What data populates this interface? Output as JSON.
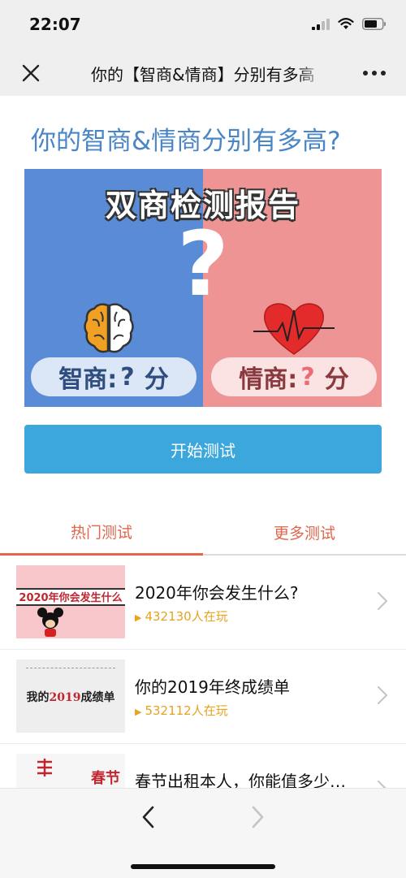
{
  "status": {
    "time": "22:07"
  },
  "nav": {
    "title": "你的【智商&情商】分别有多高"
  },
  "page": {
    "heading": "你的智商&情商分别有多高?"
  },
  "banner": {
    "title": "双商检测报告",
    "big_mark": "?",
    "iq_label": "智商:",
    "eq_label": "情商:",
    "score_placeholder": "?",
    "score_unit": "分"
  },
  "start_button": "开始测试",
  "tabs": [
    {
      "label": "热门测试",
      "active": true
    },
    {
      "label": "更多测试",
      "active": false
    }
  ],
  "list": [
    {
      "title": "2020年你会发生什么?",
      "players": "432130人在玩",
      "thumb_text": "2020年你会发生什么"
    },
    {
      "title": "你的2019年终成绩单",
      "players": "532112人在玩",
      "thumb_text_a": "我的",
      "thumb_text_b": "2019",
      "thumb_text_c": "成绩单"
    },
    {
      "title": "春节出租本人，你能值多少…",
      "players": "",
      "thumb_text": "春节"
    }
  ],
  "colors": {
    "heading": "#4a86c5",
    "banner_left": "#5a8bd6",
    "banner_right": "#ef9495",
    "button": "#3ba7dc",
    "tab_accent": "#e2654c",
    "players": "#e8a21c"
  },
  "icons": {
    "close": "close-icon",
    "more": "more-dots-icon",
    "signal": "signal-icon",
    "wifi": "wifi-icon",
    "battery": "battery-icon",
    "brain": "brain-icon",
    "heart": "heartbeat-icon",
    "chevron": "chevron-right-icon",
    "back": "back-arrow-icon",
    "forward": "forward-arrow-icon"
  }
}
